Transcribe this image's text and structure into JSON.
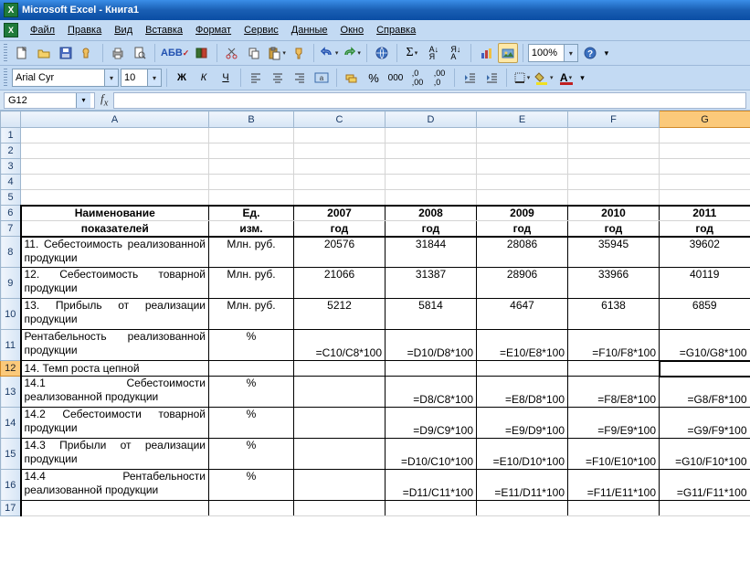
{
  "titlebar": {
    "app": "Microsoft Excel",
    "doc": "Книга1"
  },
  "menu": {
    "file": "Файл",
    "edit": "Правка",
    "view": "Вид",
    "insert": "Вставка",
    "format": "Формат",
    "tools": "Сервис",
    "data": "Данные",
    "window": "Окно",
    "help": "Справка"
  },
  "format_bar": {
    "font": "Arial Cyr",
    "size": "10",
    "bold": "Ж",
    "italic": "К",
    "underline": "Ч"
  },
  "zoom": "100%",
  "namebox": "G12",
  "formula": "",
  "columns": [
    "A",
    "B",
    "C",
    "D",
    "E",
    "F",
    "G"
  ],
  "rows": [
    "1",
    "2",
    "3",
    "4",
    "5",
    "6",
    "7",
    "8",
    "9",
    "10",
    "11",
    "12",
    "13",
    "14",
    "15",
    "16",
    "17"
  ],
  "header": {
    "a1": "Наименование",
    "a2": "показателей",
    "b1": "Ед.",
    "b2": "изм.",
    "c1": "2007",
    "c2": "год",
    "d1": "2008",
    "d2": "год",
    "e1": "2009",
    "e2": "год",
    "f1": "2010",
    "f2": "год",
    "g1": "2011",
    "g2": "год"
  },
  "chart_data": {
    "type": "table",
    "rows": [
      {
        "n": 8,
        "a": "11. Себестоимость реализованной продукции",
        "b": "Млн. руб.",
        "c": "20576",
        "d": "31844",
        "e": "28086",
        "f": "35945",
        "g": "39602"
      },
      {
        "n": 9,
        "a": "12. Себестоимость товарной продукции",
        "b": "Млн. руб.",
        "c": "21066",
        "d": "31387",
        "e": "28906",
        "f": "33966",
        "g": "40119"
      },
      {
        "n": 10,
        "a": "13. Прибыль от реализации продукции",
        "b": "Млн. руб.",
        "c": "5212",
        "d": "5814",
        "e": "4647",
        "f": "6138",
        "g": "6859"
      },
      {
        "n": 11,
        "a": "Рентабельность реализованной продукции",
        "b": "%",
        "c": "=C10/C8*100",
        "d": "=D10/D8*100",
        "e": "=E10/E8*100",
        "f": "=F10/F8*100",
        "g": "=G10/G8*100"
      },
      {
        "n": 12,
        "a": "14. Темп роста цепной",
        "b": "",
        "c": "",
        "d": "",
        "e": "",
        "f": "",
        "g": ""
      },
      {
        "n": 13,
        "a": "14.1 Себестоимости реализованной продукции",
        "b": "%",
        "c": "",
        "d": "=D8/C8*100",
        "e": "=E8/D8*100",
        "f": "=F8/E8*100",
        "g": "=G8/F8*100"
      },
      {
        "n": 14,
        "a": "14.2 Себестоимости товарной продукции",
        "b": "%",
        "c": "",
        "d": "=D9/C9*100",
        "e": "=E9/D9*100",
        "f": "=F9/E9*100",
        "g": "=G9/F9*100"
      },
      {
        "n": 15,
        "a": "14.3 Прибыли от реализации продукции",
        "b": "%",
        "c": "",
        "d": "=D10/C10*100",
        "e": "=E10/D10*100",
        "f": "=F10/E10*100",
        "g": "=G10/F10*100"
      },
      {
        "n": 16,
        "a": "14.4 Рентабельности реализованной продукции",
        "b": "%",
        "c": "",
        "d": "=D11/C11*100",
        "e": "=E11/D11*100",
        "f": "=F11/E11*100",
        "g": "=G11/F11*100"
      }
    ]
  }
}
